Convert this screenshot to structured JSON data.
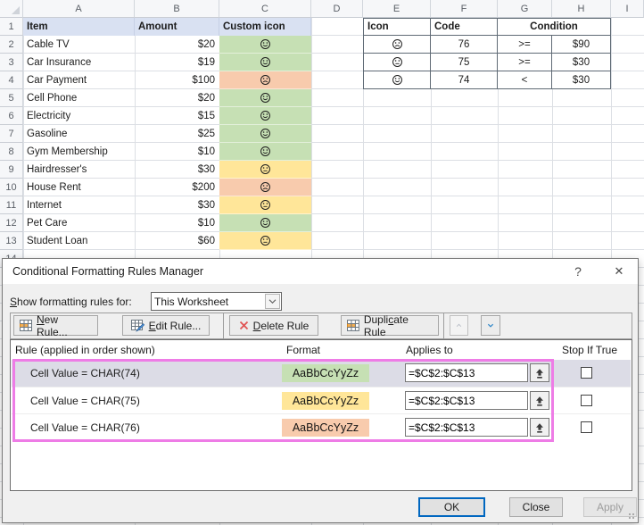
{
  "sheet": {
    "col_letters": [
      "A",
      "B",
      "C",
      "D",
      "E",
      "F",
      "G",
      "H",
      "I"
    ],
    "row_numbers": [
      "1",
      "2",
      "3",
      "4",
      "5",
      "6",
      "7",
      "8",
      "9",
      "10",
      "11",
      "12",
      "13",
      "14"
    ],
    "table1_headers": [
      "Item",
      "Amount",
      "Custom icon"
    ],
    "rows": [
      {
        "item": "Cable TV",
        "amount": "$20",
        "icon": "smile",
        "fill": "#c6e0b4"
      },
      {
        "item": "Car Insurance",
        "amount": "$19",
        "icon": "smile",
        "fill": "#c6e0b4"
      },
      {
        "item": "Car Payment",
        "amount": "$100",
        "icon": "frown",
        "fill": "#f8cbad"
      },
      {
        "item": "Cell Phone",
        "amount": "$20",
        "icon": "smile",
        "fill": "#c6e0b4"
      },
      {
        "item": "Electricity",
        "amount": "$15",
        "icon": "smile",
        "fill": "#c6e0b4"
      },
      {
        "item": "Gasoline",
        "amount": "$25",
        "icon": "smile",
        "fill": "#c6e0b4"
      },
      {
        "item": "Gym Membership",
        "amount": "$10",
        "icon": "smile",
        "fill": "#c6e0b4"
      },
      {
        "item": "Hairdresser's",
        "amount": "$30",
        "icon": "neutral",
        "fill": "#ffe699"
      },
      {
        "item": "House Rent",
        "amount": "$200",
        "icon": "frown",
        "fill": "#f8cbad"
      },
      {
        "item": "Internet",
        "amount": "$30",
        "icon": "neutral",
        "fill": "#ffe699"
      },
      {
        "item": "Pet Care",
        "amount": "$10",
        "icon": "smile",
        "fill": "#c6e0b4"
      },
      {
        "item": "Student Loan",
        "amount": "$60",
        "icon": "neutral",
        "fill": "#ffe699"
      }
    ],
    "table2": {
      "headers": {
        "icon": "Icon",
        "code": "Code",
        "condition": "Condition"
      },
      "rows": [
        {
          "icon": "frown",
          "code": "76",
          "op": ">=",
          "value": "$90"
        },
        {
          "icon": "neutral",
          "code": "75",
          "op": ">=",
          "value": "$30"
        },
        {
          "icon": "smile",
          "code": "74",
          "op": "<",
          "value": "$30"
        }
      ]
    }
  },
  "dialog": {
    "title": "Conditional Formatting Rules Manager",
    "help_glyph": "?",
    "close_glyph": "✕",
    "show_rules_label": {
      "key": "S",
      "post": "how formatting rules for:"
    },
    "scope_dropdown": {
      "value": "This Worksheet"
    },
    "toolbar": {
      "new_rule": {
        "pre": "",
        "key": "N",
        "post": "ew Rule..."
      },
      "edit_rule": {
        "pre": "",
        "key": "E",
        "post": "dit Rule..."
      },
      "delete_rule": {
        "pre": "",
        "key": "D",
        "post": "elete Rule"
      },
      "duplicate_rule": {
        "pre": "Dupli",
        "key": "c",
        "post": "ate Rule"
      }
    },
    "list": {
      "headers": {
        "rule": "Rule (applied in order shown)",
        "format": "Format",
        "applies_to": "Applies to",
        "stop": "Stop If True"
      },
      "rules": [
        {
          "rule": "Cell Value = CHAR(74)",
          "sample": "AaBbCcYyZz",
          "color": "#c6e0b4",
          "applies_to": "=$C$2:$C$13",
          "selected": "true",
          "stop_checked": false
        },
        {
          "rule": "Cell Value = CHAR(75)",
          "sample": "AaBbCcYyZz",
          "color": "#ffe699",
          "applies_to": "=$C$2:$C$13",
          "stop_checked": false
        },
        {
          "rule": "Cell Value = CHAR(76)",
          "sample": "AaBbCcYyZz",
          "color": "#f8cbad",
          "applies_to": "=$C$2:$C$13",
          "stop_checked": false
        }
      ]
    },
    "footer": {
      "ok": "OK",
      "close": "Close",
      "apply": "Apply"
    },
    "highlight_color": "#ee7ce6"
  },
  "colors": {
    "header_fill": "#d9e1f2",
    "green": "#c6e0b4",
    "yellow": "#ffe699",
    "orange": "#f8cbad",
    "selection": "#dcdce6"
  }
}
